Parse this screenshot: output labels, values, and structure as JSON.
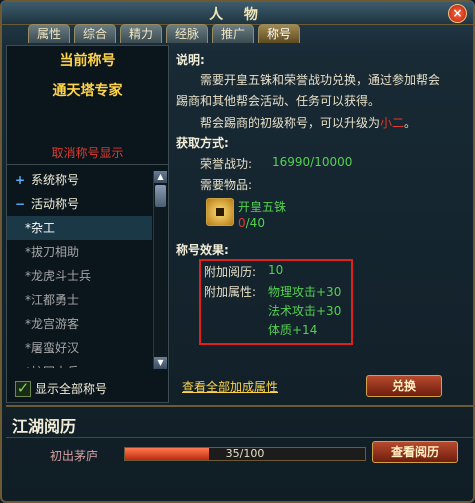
{
  "window": {
    "title": "人 物",
    "close": "×"
  },
  "tabs": [
    {
      "label": "属性",
      "active": false
    },
    {
      "label": "综合",
      "active": false
    },
    {
      "label": "精力",
      "active": false
    },
    {
      "label": "经脉",
      "active": false
    },
    {
      "label": "推广",
      "active": false
    },
    {
      "label": "称号",
      "active": true
    }
  ],
  "left": {
    "header": "当前称号",
    "current_title": "通天塔专家",
    "cancel_label": "取消称号显示",
    "tree": [
      {
        "type": "category",
        "icon": "+",
        "label": "系统称号"
      },
      {
        "type": "category",
        "icon": "−",
        "label": "活动称号"
      },
      {
        "type": "item",
        "label": "*杂工",
        "selected": true
      },
      {
        "type": "item",
        "label": "*拔刀相助",
        "selected": false
      },
      {
        "type": "item",
        "label": "*龙虎斗士兵",
        "selected": false
      },
      {
        "type": "item",
        "label": "*江都勇士",
        "selected": false
      },
      {
        "type": "item",
        "label": "*龙宫游客",
        "selected": false
      },
      {
        "type": "item",
        "label": "*屠蛮好汉",
        "selected": false
      },
      {
        "type": "item",
        "label": "*护国士兵",
        "selected": false
      }
    ],
    "show_all_label": "显示全部称号",
    "show_all_checked": true
  },
  "right": {
    "desc_heading": "说明:",
    "desc_lines": [
      "需要开皇五铢和荣誉战功兑换，通过参加帮会",
      "踢商和其他帮会活动、任务可以获得。"
    ],
    "desc_upgrade_prefix": "帮会踢商的初级称号，可以升级为",
    "desc_upgrade_target": "小二",
    "desc_upgrade_suffix": "。",
    "acquire_heading": "获取方式:",
    "honor_label": "荣誉战功:",
    "honor_value": "16990/10000",
    "need_items_label": "需要物品:",
    "item_name": "开皇五铢",
    "item_have": "0",
    "item_need": "/40",
    "effect_heading": "称号效果:",
    "effect_exp_label": "附加阅历:",
    "effect_exp_value": "10",
    "effect_attr_label": "附加属性:",
    "effect_attrs": [
      "物理攻击+30",
      "法术攻击+30",
      "体质+14"
    ],
    "view_all_link": "查看全部加成属性",
    "exchange_button": "兑换"
  },
  "bottom": {
    "title": "江湖阅历",
    "level_name": "初出茅庐",
    "progress_text": "35/100",
    "progress_fraction": 0.35,
    "view_button": "查看阅历"
  }
}
